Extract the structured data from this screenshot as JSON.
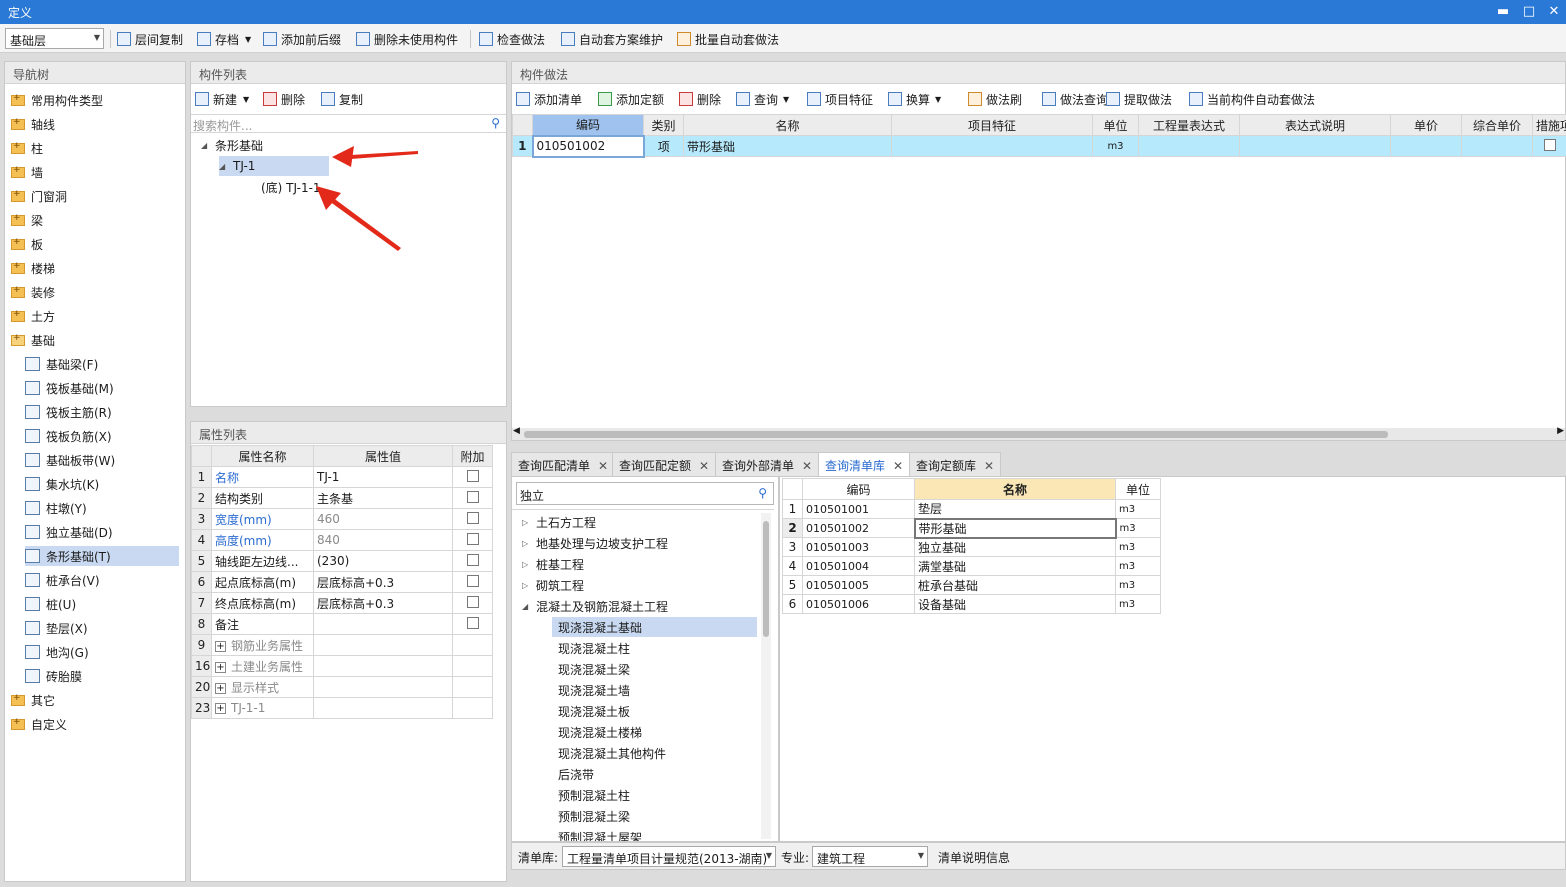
{
  "titlebar": {
    "title": "定义",
    "min": "▬",
    "max": "□",
    "close": "✕"
  },
  "toolbar": {
    "floor_value": "基础层",
    "items": [
      "层间复制",
      "存档",
      "添加前后缀",
      "删除未使用构件",
      "检查做法",
      "自动套方案维护",
      "批量自动套做法"
    ]
  },
  "nav": {
    "title": "导航树",
    "top": [
      "常用构件类型",
      "轴线",
      "柱",
      "墙",
      "门窗洞",
      "梁",
      "板",
      "楼梯",
      "装修",
      "土方"
    ],
    "foundation": "基础",
    "children": [
      "基础梁(F)",
      "筏板基础(M)",
      "筏板主筋(R)",
      "筏板负筋(X)",
      "基础板带(W)",
      "集水坑(K)",
      "柱墩(Y)",
      "独立基础(D)",
      "条形基础(T)",
      "桩承台(V)",
      "桩(U)",
      "垫层(X)",
      "地沟(G)",
      "砖胎膜"
    ],
    "bottom": [
      "其它",
      "自定义"
    ]
  },
  "components": {
    "title": "构件列表",
    "new": "新建",
    "delete": "删除",
    "copy": "复制",
    "search_placeholder": "搜索构件...",
    "tree": {
      "root": "条形基础",
      "item": "TJ-1",
      "child": "(底)  TJ-1-1"
    }
  },
  "properties": {
    "title": "属性列表",
    "headers": [
      "属性名称",
      "属性值",
      "附加"
    ],
    "rows": [
      {
        "n": "1",
        "name": "名称",
        "value": "TJ-1"
      },
      {
        "n": "2",
        "name": "结构类别",
        "value": "主条基"
      },
      {
        "n": "3",
        "name": "宽度(mm)",
        "value": "460"
      },
      {
        "n": "4",
        "name": "高度(mm)",
        "value": "840"
      },
      {
        "n": "5",
        "name": "轴线距左边线...",
        "value": "(230)"
      },
      {
        "n": "6",
        "name": "起点底标高(m)",
        "value": "层底标高+0.3"
      },
      {
        "n": "7",
        "name": "终点底标高(m)",
        "value": "层底标高+0.3"
      },
      {
        "n": "8",
        "name": "备注",
        "value": ""
      },
      {
        "n": "9",
        "name": "钢筋业务属性",
        "value": ""
      },
      {
        "n": "16",
        "name": "土建业务属性",
        "value": ""
      },
      {
        "n": "20",
        "name": "显示样式",
        "value": ""
      },
      {
        "n": "23",
        "name": "TJ-1-1",
        "value": ""
      }
    ]
  },
  "method": {
    "title": "构件做法",
    "tools": [
      "添加清单",
      "添加定额",
      "删除",
      "查询",
      "项目特征",
      "换算",
      "做法刷",
      "做法查询",
      "提取做法",
      "当前构件自动套做法"
    ],
    "headers": [
      "编码",
      "类别",
      "名称",
      "项目特征",
      "单位",
      "工程量表达式",
      "表达式说明",
      "单价",
      "综合单价",
      "措施项"
    ],
    "row": {
      "n": "1",
      "code": "010501002",
      "type": "项",
      "name": "带形基础",
      "unit": "m3"
    }
  },
  "tabs": [
    {
      "label": "查询匹配清单"
    },
    {
      "label": "查询匹配定额"
    },
    {
      "label": "查询外部清单"
    },
    {
      "label": "查询清单库"
    },
    {
      "label": "查询定额库"
    }
  ],
  "query": {
    "search_value": "独立",
    "tree": [
      "土石方工程",
      "地基处理与边坡支护工程",
      "桩基工程",
      "砌筑工程",
      "混凝土及钢筋混凝土工程"
    ],
    "subtree": [
      "现浇混凝土基础",
      "现浇混凝土柱",
      "现浇混凝土梁",
      "现浇混凝土墙",
      "现浇混凝土板",
      "现浇混凝土楼梯",
      "现浇混凝土其他构件",
      "后浇带",
      "预制混凝土柱",
      "预制混凝土梁",
      "预制混凝土屋架"
    ],
    "headers": [
      "编码",
      "名称",
      "单位"
    ],
    "rows": [
      {
        "n": "1",
        "code": "010501001",
        "name": "垫层",
        "unit": "m3"
      },
      {
        "n": "2",
        "code": "010501002",
        "name": "带形基础",
        "unit": "m3"
      },
      {
        "n": "3",
        "code": "010501003",
        "name": "独立基础",
        "unit": "m3"
      },
      {
        "n": "4",
        "code": "010501004",
        "name": "满堂基础",
        "unit": "m3"
      },
      {
        "n": "5",
        "code": "010501005",
        "name": "桩承台基础",
        "unit": "m3"
      },
      {
        "n": "6",
        "code": "010501006",
        "name": "设备基础",
        "unit": "m3"
      }
    ],
    "lib_label": "清单库:",
    "lib_value": "工程量清单项目计量规范(2013-湖南)",
    "spec_label": "专业:",
    "spec_value": "建筑工程",
    "info_label": "清单说明信息"
  }
}
